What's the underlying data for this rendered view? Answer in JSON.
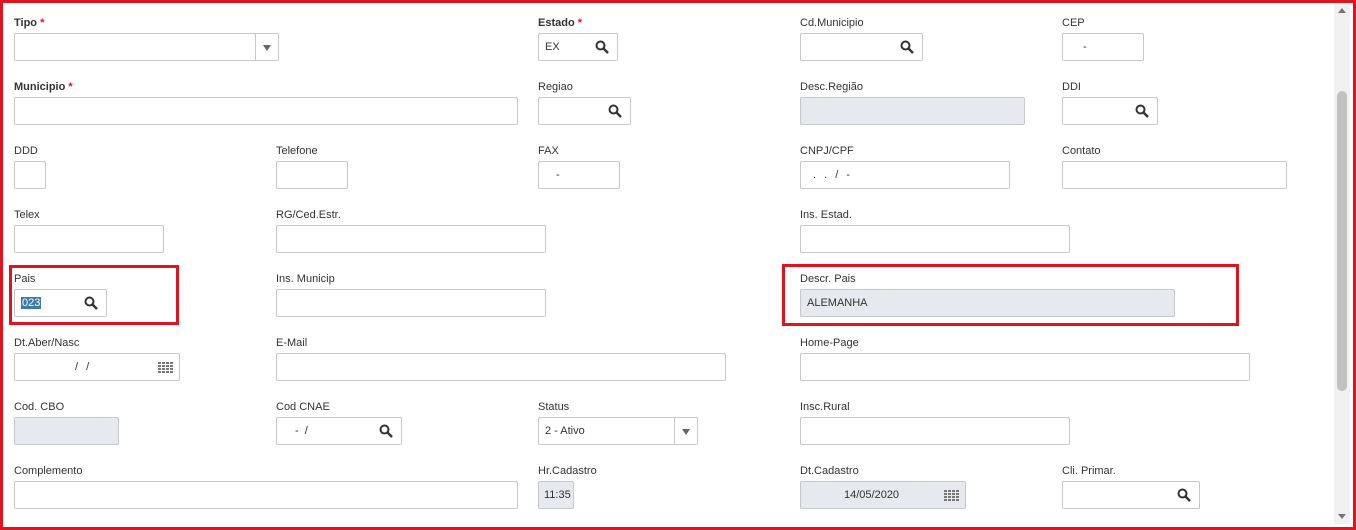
{
  "colors": {
    "accent_red": "#e0141e",
    "disabled_bg": "#e6e9ee",
    "selection_bg": "#3c7aa8"
  },
  "fields": {
    "tipo": {
      "label": "Tipo",
      "required": "*",
      "value": ""
    },
    "estado": {
      "label": "Estado",
      "required": "*",
      "value": "EX"
    },
    "cd_municipio": {
      "label": "Cd.Municipio",
      "value": ""
    },
    "cep": {
      "label": "CEP",
      "value": "-"
    },
    "municipio": {
      "label": "Municipio",
      "required": "*",
      "value": ""
    },
    "regiao": {
      "label": "Regiao",
      "value": ""
    },
    "desc_regiao": {
      "label": "Desc.Região",
      "value": ""
    },
    "ddi": {
      "label": "DDI",
      "value": ""
    },
    "ddd": {
      "label": "DDD",
      "value": ""
    },
    "telefone": {
      "label": "Telefone",
      "value": ""
    },
    "fax": {
      "label": "FAX",
      "value": "-"
    },
    "cnpj_cpf": {
      "label": "CNPJ/CPF",
      "value": ". . / -"
    },
    "contato": {
      "label": "Contato",
      "value": ""
    },
    "telex": {
      "label": "Telex",
      "value": ""
    },
    "rg_ced_estr": {
      "label": "RG/Ced.Estr.",
      "value": ""
    },
    "ins_estad": {
      "label": "Ins. Estad.",
      "value": ""
    },
    "pais": {
      "label": "Pais",
      "value": "023"
    },
    "ins_municip": {
      "label": "Ins. Municip",
      "value": ""
    },
    "descr_pais": {
      "label": "Descr. Pais",
      "value": "ALEMANHA"
    },
    "dt_aber_nasc": {
      "label": "Dt.Aber/Nasc",
      "value": "/ /"
    },
    "email": {
      "label": "E-Mail",
      "value": ""
    },
    "home_page": {
      "label": "Home-Page",
      "value": ""
    },
    "cod_cbo": {
      "label": "Cod. CBO",
      "value": ""
    },
    "cod_cnae": {
      "label": "Cod CNAE",
      "value": "- /"
    },
    "status": {
      "label": "Status",
      "value": "2 - Ativo"
    },
    "insc_rural": {
      "label": "Insc.Rural",
      "value": ""
    },
    "complemento": {
      "label": "Complemento",
      "value": ""
    },
    "hr_cadastro": {
      "label": "Hr.Cadastro",
      "value": "11:35"
    },
    "dt_cadastro": {
      "label": "Dt.Cadastro",
      "value": "14/05/2020"
    },
    "cli_primar": {
      "label": "Cli. Primar.",
      "value": ""
    }
  }
}
